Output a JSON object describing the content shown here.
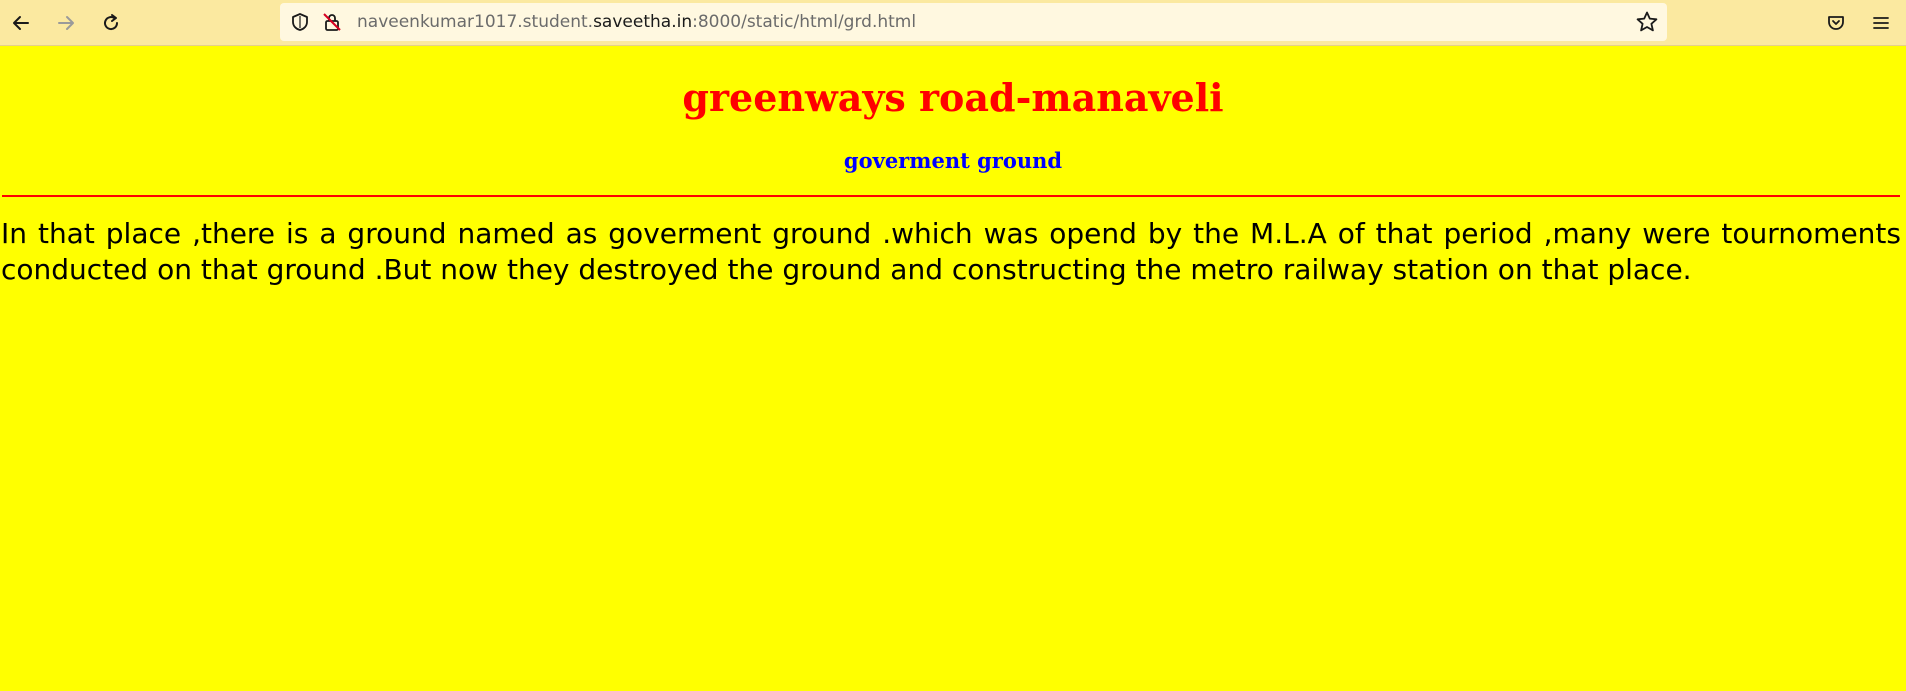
{
  "browser": {
    "url_prefix": "naveenkumar1017.student.",
    "url_domain": "saveetha.in",
    "url_suffix": ":8000/static/html/grd.html",
    "toolbar_color": "#fbe9a0"
  },
  "icons": {
    "back": "arrow-left-icon",
    "forward": "arrow-right-icon",
    "reload": "reload-icon",
    "shield": "shield-icon",
    "lock": "insecure-lock-icon",
    "bookmark": "star-icon",
    "pocket": "pocket-icon",
    "menu": "hamburger-menu-icon"
  },
  "page": {
    "background": "#ffff00",
    "heading": "greenways road-manaveli",
    "heading_color": "#ff0000",
    "subheading": "goverment ground",
    "subheading_color": "#0000ff",
    "body_text": "In that place ,there is a ground named as goverment ground .which was opend by the M.L.A of that period ,many were tournoments conducted on that ground .But now they destroyed the ground and constructing the metro railway station on that place."
  }
}
